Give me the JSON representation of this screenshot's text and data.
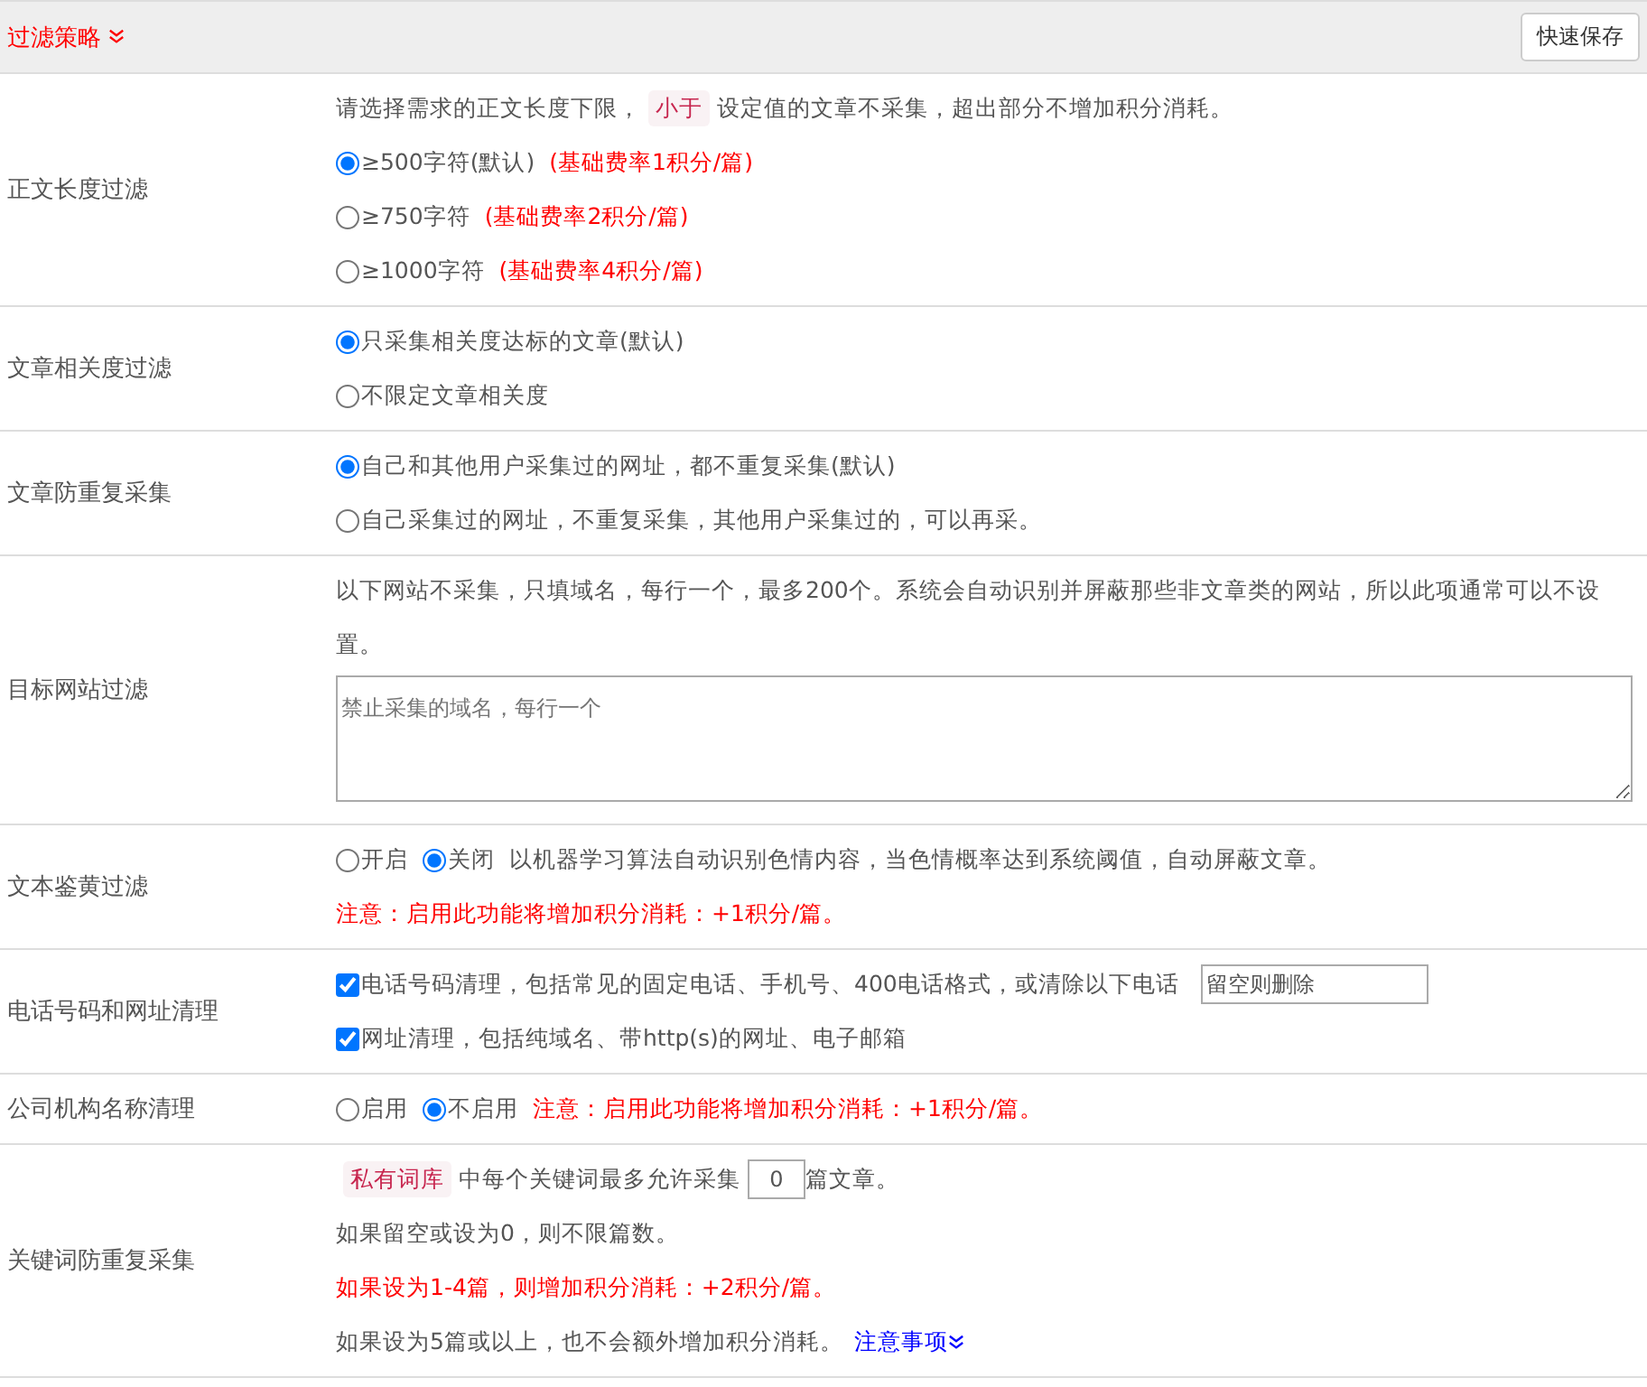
{
  "header": {
    "title": "过滤策略",
    "save_button": "快速保存"
  },
  "rows": [
    {
      "label": "正文长度过滤",
      "lines": [
        [
          {
            "kind": "text",
            "text": "请选择需求的正文长度下限，"
          },
          {
            "kind": "tag",
            "text": "小于"
          },
          {
            "kind": "text",
            "text": "设定值的文章不采集，超出部分不增加积分消耗。"
          }
        ],
        [
          {
            "kind": "radio",
            "text": "≥500字符(默认)",
            "selected": true
          },
          {
            "kind": "red",
            "text": "(基础费率1积分/篇)"
          }
        ],
        [
          {
            "kind": "radio",
            "text": "≥750字符",
            "selected": false
          },
          {
            "kind": "red",
            "text": "(基础费率2积分/篇)"
          }
        ],
        [
          {
            "kind": "radio",
            "text": "≥1000字符",
            "selected": false
          },
          {
            "kind": "red",
            "text": "(基础费率4积分/篇)"
          }
        ]
      ]
    },
    {
      "label": "文章相关度过滤",
      "lines": [
        [
          {
            "kind": "radio",
            "text": "只采集相关度达标的文章(默认)",
            "selected": true
          }
        ],
        [
          {
            "kind": "radio",
            "text": "不限定文章相关度",
            "selected": false
          }
        ]
      ]
    },
    {
      "label": "文章防重复采集",
      "lines": [
        [
          {
            "kind": "radio",
            "text": "自己和其他用户采集过的网址，都不重复采集(默认)",
            "selected": true
          }
        ],
        [
          {
            "kind": "radio",
            "text": "自己采集过的网址，不重复采集，其他用户采集过的，可以再采。",
            "selected": false
          }
        ]
      ]
    },
    {
      "label": "目标网站过滤",
      "lines": [
        [
          {
            "kind": "text",
            "text": "以下网站不采集，只填域名，每行一个，最多200个。系统会自动识别并屏蔽那些非文章类的网站，所以此项通常可以不设置。"
          }
        ],
        [
          {
            "kind": "textarea",
            "placeholder": "禁止采集的域名，每行一个"
          }
        ]
      ]
    },
    {
      "label": "文本鉴黄过滤",
      "lines": [
        [
          {
            "kind": "radio",
            "text": "开启",
            "selected": false
          },
          {
            "kind": "radio",
            "text": "关闭",
            "selected": true
          },
          {
            "kind": "text",
            "text": "以机器学习算法自动识别色情内容，当色情概率达到系统阈值，自动屏蔽文章。"
          }
        ],
        [
          {
            "kind": "red",
            "text": "注意：启用此功能将增加积分消耗：+1积分/篇。"
          }
        ]
      ]
    },
    {
      "label": "电话号码和网址清理",
      "lines": [
        [
          {
            "kind": "checkbox",
            "text": "电话号码清理，包括常见的固定电话、手机号、400电话格式，或清除以下电话",
            "checked": true
          },
          {
            "kind": "input",
            "value": "留空则删除"
          }
        ],
        [
          {
            "kind": "checkbox",
            "text": "网址清理，包括纯域名、带http(s)的网址、电子邮箱",
            "checked": true
          }
        ]
      ]
    },
    {
      "label": "公司机构名称清理",
      "lines": [
        [
          {
            "kind": "radio",
            "text": "启用",
            "selected": false
          },
          {
            "kind": "radio",
            "text": "不启用",
            "selected": true
          },
          {
            "kind": "red",
            "text": "注意：启用此功能将增加积分消耗：+1积分/篇。"
          }
        ]
      ]
    },
    {
      "label": "关键词防重复采集",
      "lines": [
        [
          {
            "kind": "tag",
            "text": "私有词库"
          },
          {
            "kind": "text",
            "text": "中每个关键词最多允许采集"
          },
          {
            "kind": "number",
            "value": "0"
          },
          {
            "kind": "text",
            "text": "篇文章。"
          }
        ],
        [
          {
            "kind": "text",
            "text": "如果留空或设为0，则不限篇数。"
          }
        ],
        [
          {
            "kind": "red",
            "text": "如果设为1-4篇，则增加积分消耗：+2积分/篇。"
          }
        ],
        [
          {
            "kind": "text",
            "text": "如果设为5篇或以上，也不会额外增加积分消耗。"
          },
          {
            "kind": "link",
            "text": "注意事项"
          }
        ]
      ]
    }
  ]
}
